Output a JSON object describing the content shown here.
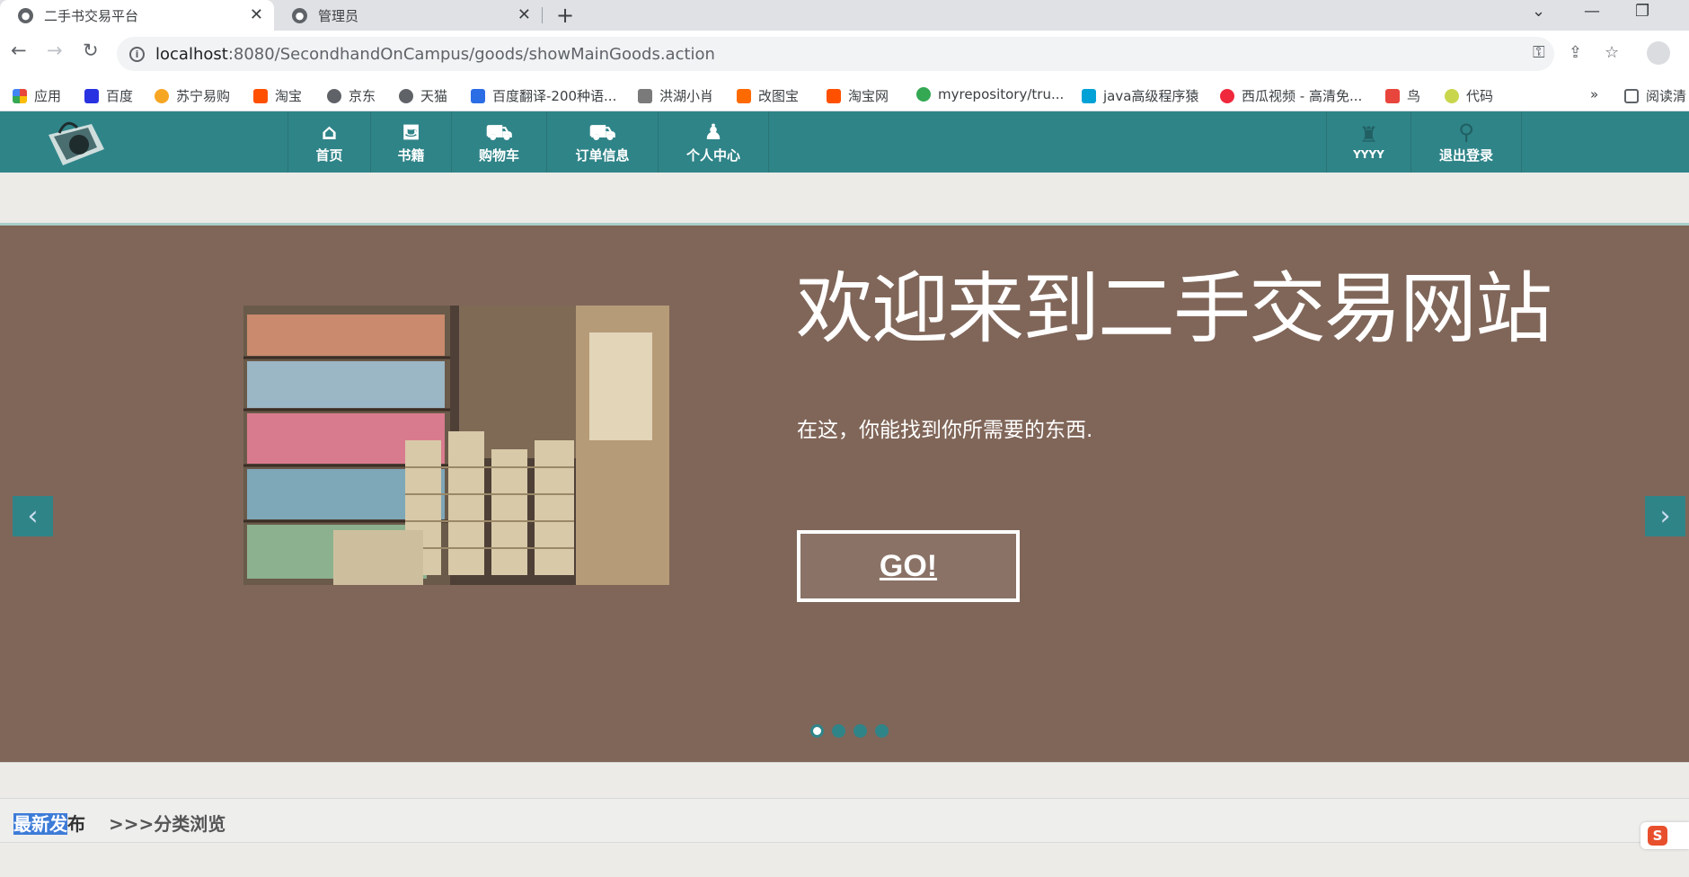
{
  "browser": {
    "tabs": [
      {
        "title": "二手书交易平台",
        "active": true
      },
      {
        "title": "管理员",
        "active": false
      }
    ],
    "url_host": "localhost",
    "url_path": ":8080/SecondhandOnCampus/goods/showMainGoods.action",
    "bookmarks": [
      {
        "label": "应用",
        "color": "#e8453c"
      },
      {
        "label": "百度",
        "color": "#2932e1"
      },
      {
        "label": "苏宁易购",
        "color": "#f6a623"
      },
      {
        "label": "淘宝",
        "color": "#ff5000"
      },
      {
        "label": "京东",
        "color": "#5f6368"
      },
      {
        "label": "天猫",
        "color": "#5f6368"
      },
      {
        "label": "百度翻译-200种语...",
        "color": "#2b6de5"
      },
      {
        "label": "洪湖小肖",
        "color": "#7a7a7a"
      },
      {
        "label": "改图宝",
        "color": "#ff6a00"
      },
      {
        "label": "淘宝网",
        "color": "#ff5000"
      },
      {
        "label": "myrepository/tru...",
        "color": "#34a853"
      },
      {
        "label": "java高级程序猿",
        "color": "#00a1d6"
      },
      {
        "label": "西瓜视频 - 高清免...",
        "color": "#f0283c"
      },
      {
        "label": "鸟",
        "color": "#e8453c"
      },
      {
        "label": "代码",
        "color": "#c9d64c"
      }
    ],
    "bookmarks_overflow": "»",
    "reading_list": "阅读清"
  },
  "site": {
    "nav": [
      {
        "label": "首页",
        "icon": "home-icon",
        "glyph": "⌂"
      },
      {
        "label": "书籍",
        "icon": "basket-icon",
        "glyph": "🧺"
      },
      {
        "label": "购物车",
        "icon": "cart-icon",
        "glyph": "🛒"
      },
      {
        "label": "订单信息",
        "icon": "truck-icon",
        "glyph": "🚚"
      },
      {
        "label": "个人中心",
        "icon": "user-add-icon",
        "glyph": "👤"
      }
    ],
    "user": {
      "label": "YYYY",
      "icon": "user-group-icon"
    },
    "logout": {
      "label": "退出登录",
      "icon": "pin-icon"
    },
    "accent_color": "#2f8488"
  },
  "hero": {
    "title": "欢迎来到二手交易网站",
    "subtitle": "在这，你能找到你所需要的东西.",
    "button_label": "GO!",
    "prev": "‹",
    "next": "›",
    "slide_count": 4,
    "active_slide": 1,
    "background_color": "#806659"
  },
  "section": {
    "latest_selected": "最新发",
    "latest_rest": "布",
    "browse_label": ">>>分类浏览"
  },
  "ime_badge": "S"
}
